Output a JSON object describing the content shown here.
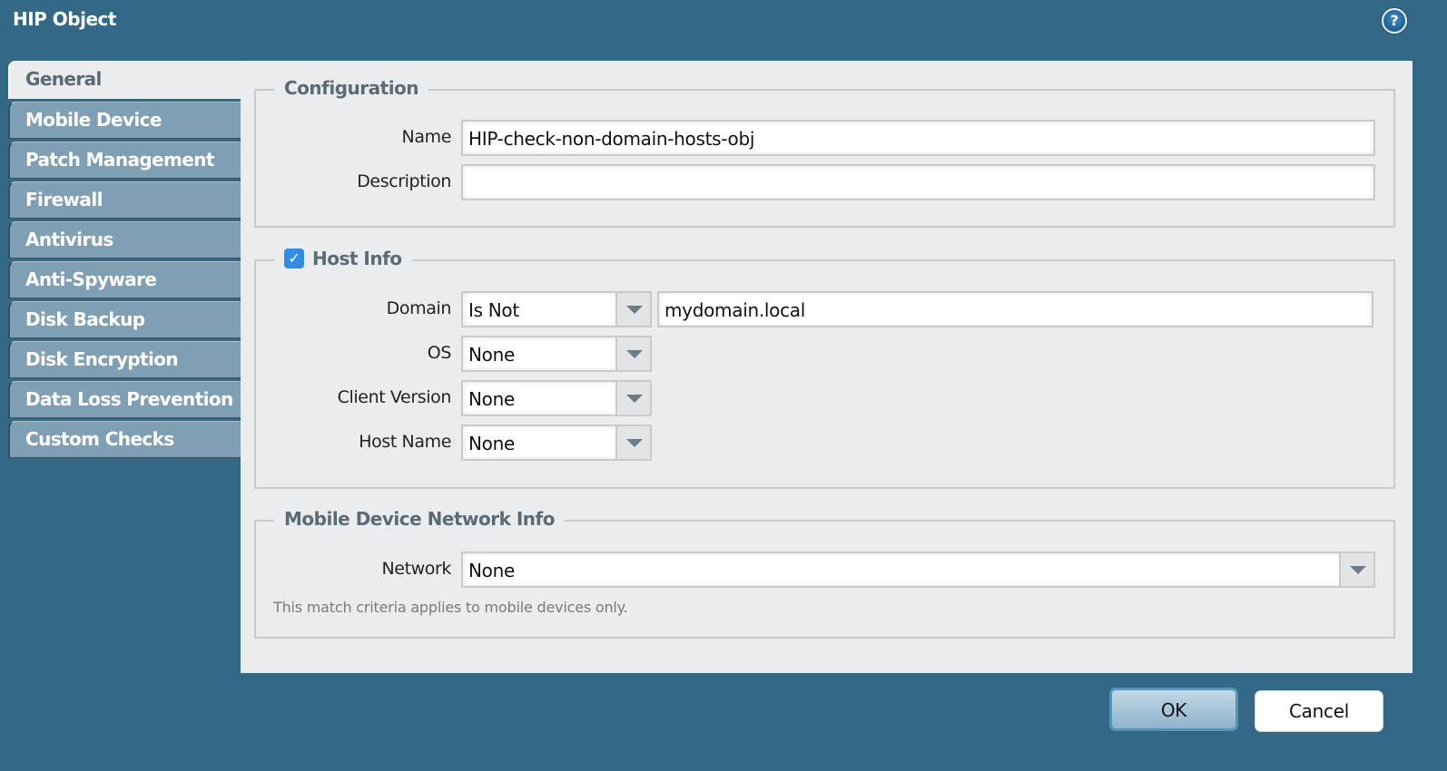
{
  "window": {
    "title": "HIP Object",
    "help_icon": "help-icon",
    "help_glyph": "?"
  },
  "tabs": [
    {
      "label": "General",
      "active": true
    },
    {
      "label": "Mobile Device",
      "active": false
    },
    {
      "label": "Patch Management",
      "active": false
    },
    {
      "label": "Firewall",
      "active": false
    },
    {
      "label": "Antivirus",
      "active": false
    },
    {
      "label": "Anti-Spyware",
      "active": false
    },
    {
      "label": "Disk Backup",
      "active": false
    },
    {
      "label": "Disk Encryption",
      "active": false
    },
    {
      "label": "Data Loss Prevention",
      "active": false
    },
    {
      "label": "Custom Checks",
      "active": false
    }
  ],
  "configuration": {
    "legend": "Configuration",
    "name_label": "Name",
    "name_value": "HIP-check-non-domain-hosts-obj",
    "description_label": "Description",
    "description_value": ""
  },
  "host_info": {
    "legend": "Host Info",
    "checked": true,
    "check_glyph": "✓",
    "domain_label": "Domain",
    "domain_operator": "Is Not",
    "domain_value": "mydomain.local",
    "os_label": "OS",
    "os_value": "None",
    "client_version_label": "Client Version",
    "client_version_value": "None",
    "host_name_label": "Host Name",
    "host_name_value": "None"
  },
  "mobile_network": {
    "legend": "Mobile Device Network Info",
    "network_label": "Network",
    "network_value": "None",
    "note": "This match criteria applies to mobile devices only."
  },
  "buttons": {
    "ok": "OK",
    "cancel": "Cancel"
  },
  "colors": {
    "background": "#336987",
    "panel": "#ebecee",
    "tab_inactive": "#7e9fb4",
    "checkbox": "#2f8de4"
  }
}
